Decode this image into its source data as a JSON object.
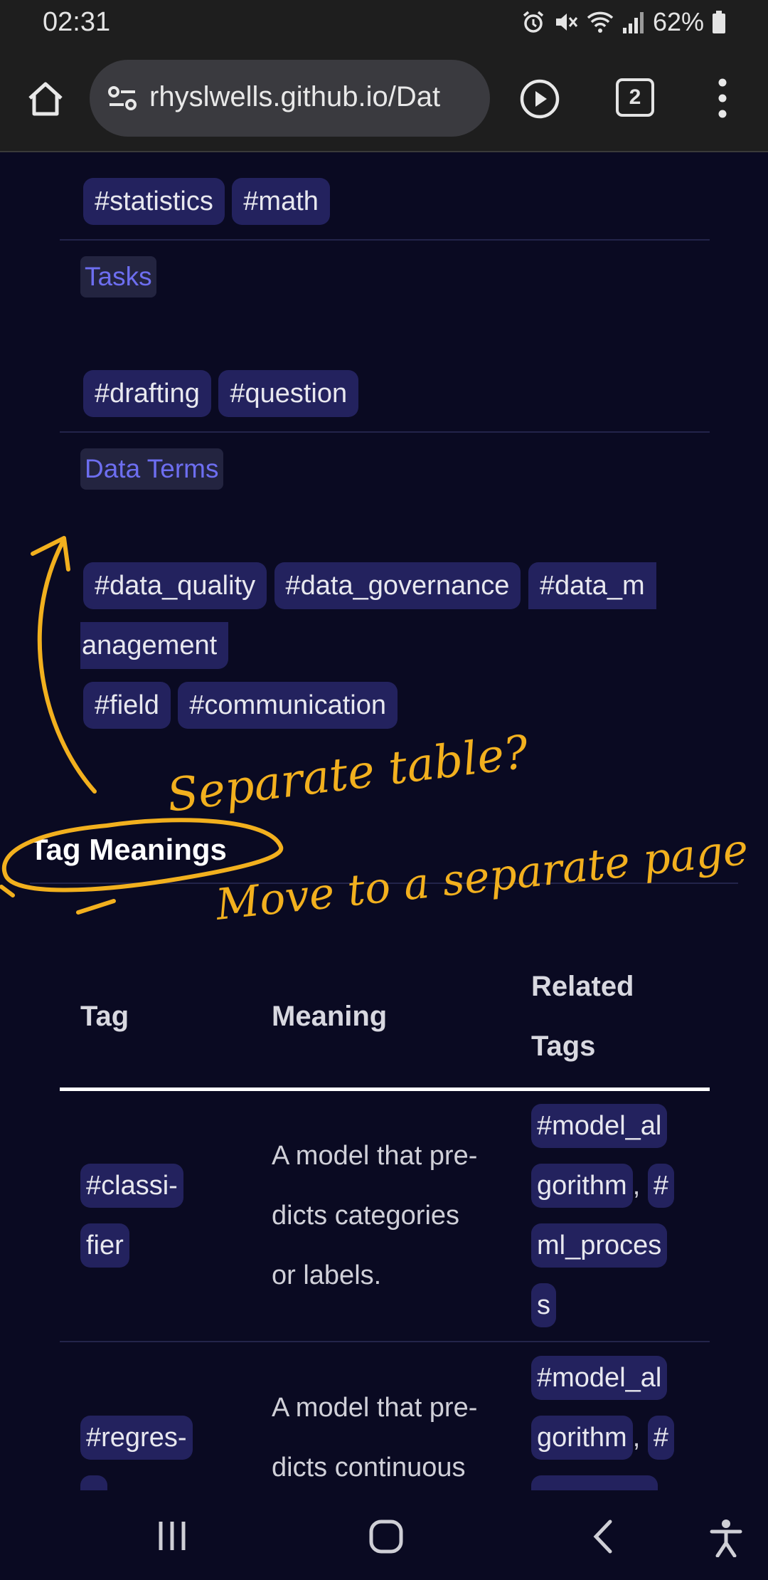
{
  "status_bar": {
    "time": "02:31",
    "battery": "62%"
  },
  "browser": {
    "url": "rhyslwells.github.io/Dat",
    "tab_count": "2"
  },
  "sections": [
    {
      "tags": [
        "#statistics",
        "#math"
      ]
    },
    {
      "title": "Tasks",
      "tags": [
        "#drafting",
        "#question"
      ]
    },
    {
      "title": "Data Terms",
      "tags_line1": [
        "#data_quality",
        "#data_governance"
      ],
      "tag_wrap_start": "#data_m",
      "tag_wrap_end": "anagement",
      "tags_line3": [
        "#field",
        "#communication"
      ]
    }
  ],
  "tag_meanings": {
    "heading": "Tag Meanings",
    "columns": {
      "tag": "Tag",
      "meaning": "Meaning",
      "related_1": "Related",
      "related_2": "Tags"
    },
    "rows": [
      {
        "tag_1": "#classi-",
        "tag_2": "fier",
        "meaning_1": "A model that pre-",
        "meaning_2": "dicts categories",
        "meaning_3": "or labels.",
        "related": {
          "l1": "#model_al",
          "l2a": "gorithm",
          "comma": ",",
          "l2b": "#",
          "l3": "ml_proces",
          "l4": "s"
        }
      },
      {
        "tag_1": "#regres-",
        "meaning_1": "A model that pre-",
        "meaning_2": "dicts continuous",
        "related": {
          "l1": "#model_al",
          "l2a": "gorithm",
          "comma": ",",
          "l2b": "#"
        }
      }
    ]
  },
  "annotations": {
    "note_1": "Separate table?",
    "note_2": "Move to a separate page",
    "ink_color": "#f2b01e"
  },
  "colors": {
    "background": "#0a0a22",
    "tag_bg": "#23225e",
    "link": "#6d6ef0"
  }
}
